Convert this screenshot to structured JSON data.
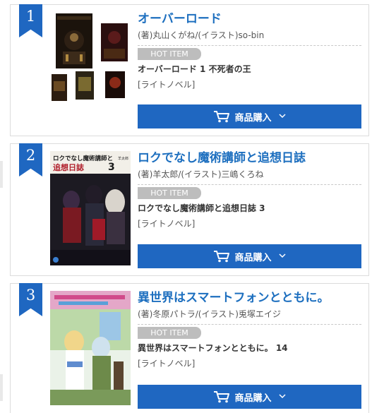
{
  "rankings": [
    {
      "rank": "1",
      "title": "オーバーロード",
      "author": "(著)丸山くがね/(イラスト)so-bin",
      "hot_label": "HOT ITEM",
      "item_name": "オーバーロード 1 不死者の王",
      "category": "[ライトノベル]",
      "buy_label": "商品購入"
    },
    {
      "rank": "2",
      "title": "ロクでなし魔術講師と追想日誌",
      "author": "(著)羊太郎/(イラスト)三嶋くろね",
      "hot_label": "HOT ITEM",
      "item_name": "ロクでなし魔術講師と追想日誌 3",
      "category": "[ライトノベル]",
      "buy_label": "商品購入",
      "cover_text": {
        "title_line1": "ロクでなし魔術講師と",
        "title_line2": "追想日誌",
        "volume": "3",
        "author": "羊太郎"
      }
    },
    {
      "rank": "3",
      "title": "異世界はスマートフォンとともに。",
      "author": "(著)冬原パトラ/(イラスト)兎塚エイジ",
      "hot_label": "HOT ITEM",
      "item_name": "異世界はスマートフォンとともに。 14",
      "category": "[ライトノベル]",
      "buy_label": "商品購入"
    }
  ],
  "colors": {
    "accent": "#1f67c1",
    "title": "#1d6fbf",
    "badge": "#bdbdbd"
  },
  "icons": {
    "cart": "cart-icon",
    "chevron": "chevron-down-icon"
  }
}
